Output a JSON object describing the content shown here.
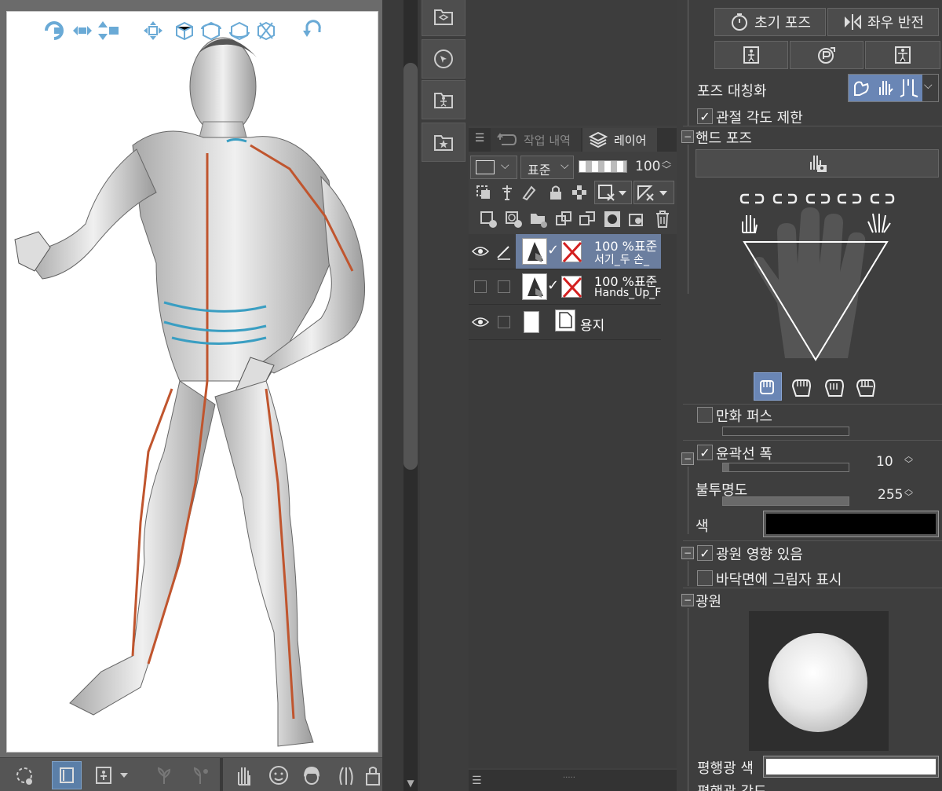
{
  "canvas": {
    "toolbar_top_icons": [
      "rotate-camera-icon",
      "pan-camera-icon",
      "dolly-camera-icon",
      "move-object-icon",
      "rotate-object-icon",
      "rotate-object-alt-icon",
      "rotate-object-3d-icon",
      "snap-object-icon",
      "undo-arrow-icon"
    ],
    "bottom_tools": [
      "object-rotate-icon",
      "flip-icon",
      "pose-dropdown-icon",
      "plant-icon",
      "plant-alt-icon",
      "hand-icon",
      "face-icon",
      "hair-icon",
      "body-icon",
      "bag-icon"
    ]
  },
  "layer_panel": {
    "tabs": [
      {
        "label": "작업 내역",
        "active": false
      },
      {
        "label": "레이어",
        "active": true
      }
    ],
    "blend_mode": "표준",
    "opacity": "100",
    "layers": [
      {
        "opacity_blend": "100 %표준",
        "name": "서기_두 손_",
        "selected": true,
        "visible": true,
        "editing": true
      },
      {
        "opacity_blend": "100 %표준",
        "name": "Hands_Up_Fr",
        "selected": false,
        "visible": false,
        "editing": false
      },
      {
        "opacity_blend": "",
        "name": "용지",
        "selected": false,
        "visible": true,
        "editing": false
      }
    ]
  },
  "props": {
    "initial_pose": "초기 포즈",
    "flip_lr": "좌우 반전",
    "pose_symmetry": "포즈 대칭화",
    "joint_limit": "관절 각도 제한",
    "hand_pose": "핸드 포즈",
    "manga_perspective": "만화 퍼스",
    "outline_width": "윤곽선 폭",
    "outline_width_value": "10",
    "opacity_label": "불투명도",
    "opacity_value": "255",
    "color_label": "색",
    "color_value": "#000000",
    "light_effect": "광원 영향 있음",
    "floor_shadow": "바닥면에 그림자 표시",
    "light_source": "광원",
    "parallel_light_color": "평행광 색",
    "parallel_light_angle": "평행광 각도",
    "joint_limit_checked": true,
    "manga_perspective_checked": false,
    "outline_checked": true,
    "light_effect_checked": true,
    "floor_shadow_checked": false,
    "outline_width_level": 0.05,
    "opacity_level": 1.0
  }
}
